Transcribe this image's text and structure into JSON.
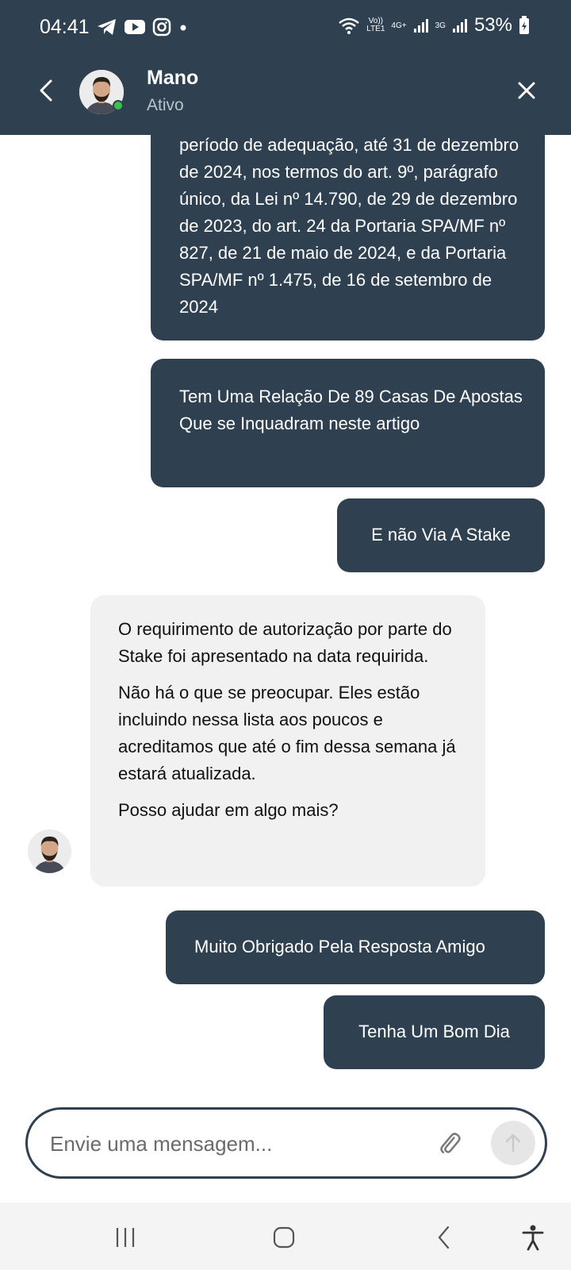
{
  "status_bar": {
    "time": "04:41",
    "icons_left": [
      "telegram-icon",
      "youtube-icon",
      "instagram-icon",
      "dot-icon"
    ],
    "volte_top": "Vo))",
    "volte_bottom": "LTE1",
    "net1": "4G+",
    "net2": "3G",
    "battery": "53%"
  },
  "header": {
    "name": "Mano",
    "status": "Ativo"
  },
  "messages": {
    "out1": "período de adequação, até 31 de dezembro de 2024, nos termos do art. 9º, parágrafo único, da Lei nº 14.790, de 29 de dezembro de 2023, do art. 24 da Portaria SPA/MF nº 827, de 21 de maio de 2024, e da Portaria SPA/MF nº 1.475, de 16 de setembro de 2024",
    "out2": "Tem Uma Relação De 89 Casas De Apostas Que se Inquadram neste artigo",
    "out3": "E não Via A Stake",
    "in1": {
      "p1": "O requirimento de autorização por parte do Stake foi apresentado na data requirida.",
      "p2": "Não há o que se preocupar. Eles estão incluindo nessa lista aos poucos e acreditamos que até o fim dessa semana já estará atualizada.",
      "p3": "Posso ajudar em algo mais?"
    },
    "out4": "Muito Obrigado Pela Resposta Amigo",
    "out5": "Tenha Um Bom Dia"
  },
  "composer": {
    "placeholder": "Envie uma mensagem..."
  },
  "colors": {
    "header_bg": "#2f4150",
    "bubble_out": "#2f4150",
    "bubble_in": "#f1f1f2",
    "online": "#3cc14a"
  }
}
